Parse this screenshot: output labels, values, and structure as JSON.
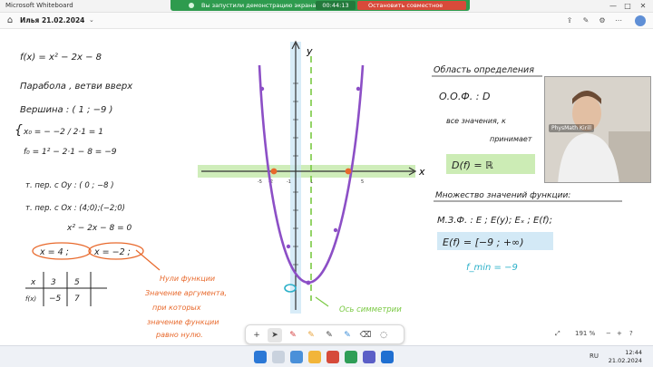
{
  "window": {
    "title": "Microsoft Whiteboard"
  },
  "share_banner": {
    "status": "Вы запустили демонстрацию экрана",
    "timer": "00:44:13",
    "stop_label": "Остановить совместное использование"
  },
  "board": {
    "title": "Илья 21.02.2024"
  },
  "notes_left": {
    "line1": "f(x) = x² − 2x − 8",
    "line2": "Парабола , ветви вверх",
    "line3": "Вершина : ( 1 ; −9 )",
    "line4a": "x₀ = − −2 / 2·1 = 1",
    "line4b": "f₀ = 1² − 2·1 − 8 = −9",
    "line5": "т. пер. с Oy : ( 0 ; −8 )",
    "line6": "т. пер. с Ox : (4;0);(−2;0)",
    "line7": "x² − 2x − 8 = 0",
    "root1": "x = 4 ;",
    "root2": "x = −2 ;",
    "table_h": [
      "x",
      "3",
      "5"
    ],
    "table_r": [
      "f(x)",
      "−5",
      "7"
    ]
  },
  "notes_orange": [
    "Нули функции",
    "Значение аргумента,",
    "при которых",
    "значение функции",
    "равно нулю."
  ],
  "axis_note": "Ось симметрии",
  "notes_right": {
    "domain_title": "Область определения",
    "domain_line": "О.О.Ф. : D",
    "domain_text": "все значения, к",
    "domain_text2": "принимает",
    "domain_result": "D(f) = ℝ",
    "range_title": "Множество значений функции:",
    "range_line": "М.З.Ф. : E ; E(y); Eₓ ; E(f);",
    "range_result": "E(f) = [−9 ; +∞)",
    "fmin": "f_min = −9"
  },
  "graph": {
    "y_label": "y",
    "x_label": "x",
    "x_ticks": [
      "-5",
      "-2",
      "-1",
      "1",
      "5"
    ],
    "curve_color": "#8c4fc6",
    "axis_color": "#2bb0c9",
    "band_color": "#bfe7a3",
    "sym_color": "#7ac943",
    "point_color": "#e8692c"
  },
  "webcam": {
    "name": "PhysMath Kirill"
  },
  "zoom": {
    "level": "191 %"
  },
  "clock": {
    "time": "12:44",
    "date": "21.02.2024"
  },
  "tray": {
    "lang": "RU"
  }
}
